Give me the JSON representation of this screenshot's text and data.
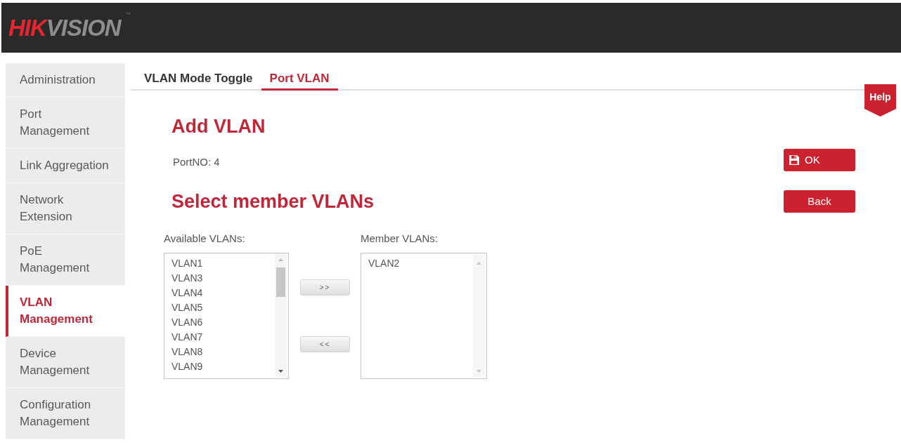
{
  "header": {
    "logo": [
      {
        "kind": "accent",
        "text": "HIK"
      },
      {
        "kind": "base",
        "text": "VISION"
      },
      {
        "kind": "trademark",
        "text": "™"
      }
    ]
  },
  "sidebar": {
    "items": [
      {
        "lines": [
          "Administration"
        ],
        "selected": false
      },
      {
        "lines": [
          "Port",
          "Management"
        ],
        "selected": false
      },
      {
        "lines": [
          "Link Aggregation"
        ],
        "selected": false
      },
      {
        "lines": [
          "Network",
          "Extension"
        ],
        "selected": false
      },
      {
        "lines": [
          "PoE",
          "Management"
        ],
        "selected": false
      },
      {
        "lines": [
          "VLAN",
          "Management"
        ],
        "selected": true
      },
      {
        "lines": [
          "Device",
          "Management"
        ],
        "selected": false
      },
      {
        "lines": [
          "Configuration",
          "Management"
        ],
        "selected": false
      }
    ]
  },
  "tabs": [
    {
      "label": "VLAN Mode Toggle",
      "selected": false
    },
    {
      "label": "Port VLAN",
      "selected": true
    }
  ],
  "help_tab": {
    "label": "Help"
  },
  "form": {
    "title": "Add VLAN",
    "port_info": "PortNO: 4",
    "section_title": "Select member VLANs"
  },
  "buttons": [
    {
      "kind": "save",
      "label": "OK"
    },
    {
      "kind": "plain",
      "label": "Back"
    }
  ],
  "vlan_picker": {
    "available": {
      "label": "Available VLANs:",
      "options": [
        {
          "text": "VLAN1",
          "selected": false
        },
        {
          "text": "VLAN3",
          "selected": false
        },
        {
          "text": "VLAN4",
          "selected": false
        },
        {
          "text": "VLAN5",
          "selected": false
        },
        {
          "text": "VLAN6",
          "selected": false
        },
        {
          "text": "VLAN7",
          "selected": false
        },
        {
          "text": "VLAN8",
          "selected": false
        },
        {
          "text": "VLAN9",
          "selected": false
        }
      ]
    },
    "move_buttons": [
      {
        "label": ">>"
      },
      {
        "label": "<<"
      }
    ],
    "member": {
      "label": "Member VLANs:",
      "options": [
        {
          "text": "VLAN2",
          "selected": false
        }
      ]
    }
  }
}
